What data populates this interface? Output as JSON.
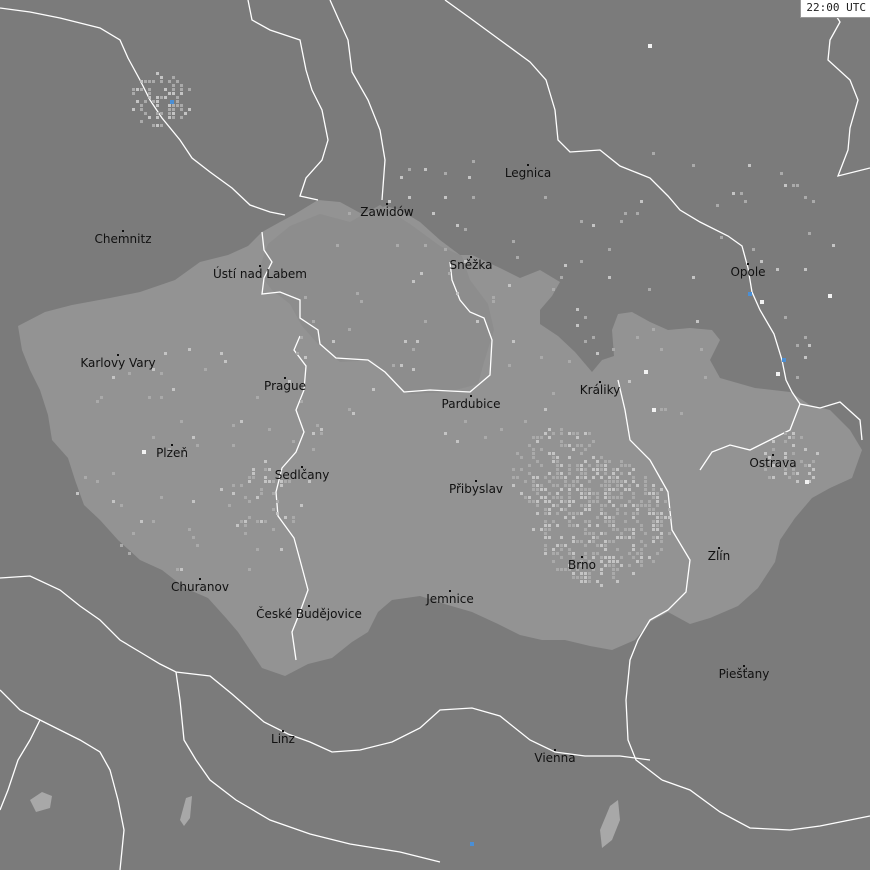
{
  "timestamp": "22:00 UTC",
  "colors": {
    "background": "#7b7b7b",
    "region": "#939393",
    "border": "#ffffff",
    "strike_density": "#b9b9b9",
    "strike_recent": "#4a8fd6",
    "strike_white": "#f2f2f2"
  },
  "cities": [
    {
      "name": "Legnica"
    },
    {
      "name": "Zawidów"
    },
    {
      "name": "Chemnitz"
    },
    {
      "name": "Ústí nad Labem"
    },
    {
      "name": "Sněžka"
    },
    {
      "name": "Opole"
    },
    {
      "name": "Karlovy Vary"
    },
    {
      "name": "Prague"
    },
    {
      "name": "Králiky"
    },
    {
      "name": "Pardubice"
    },
    {
      "name": "Plzeň"
    },
    {
      "name": "Ostrava"
    },
    {
      "name": "Sedlčany"
    },
    {
      "name": "Přibyslav"
    },
    {
      "name": "Zlín"
    },
    {
      "name": "Brno"
    },
    {
      "name": "Churanov"
    },
    {
      "name": "České Budějovice"
    },
    {
      "name": "Jemnice"
    },
    {
      "name": "Piešťany"
    },
    {
      "name": "Linz"
    },
    {
      "name": "Vienna"
    }
  ]
}
